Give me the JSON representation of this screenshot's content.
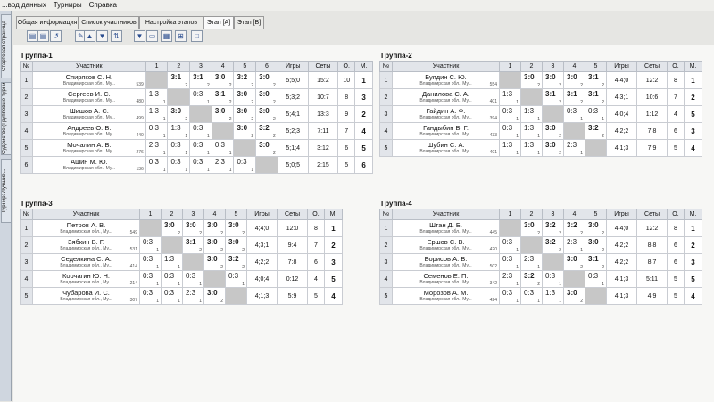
{
  "menu": [
    "...вод данных",
    "Турниры",
    "Справка"
  ],
  "sidebar_tabs": [
    "Стартовая страница",
    "Судейство (Групповые турниры)",
    "Турнир: Лучшие..."
  ],
  "main_tabs": [
    "Общая информация",
    "Список участников",
    "Настройка этапов",
    "Этап [А]",
    "Этап [B]"
  ],
  "active_tab": 3,
  "toolbar_icons": [
    {
      "glyph": "▤",
      "name": "grid-icon"
    },
    {
      "glyph": "▤",
      "name": "grid-icon"
    },
    {
      "glyph": "↺",
      "name": "refresh-icon"
    },
    {
      "glyph": "✎",
      "name": "edit-icon"
    },
    {
      "glyph": "▲",
      "name": "up-arrow-icon"
    },
    {
      "glyph": "▼",
      "name": "down-arrow-icon"
    },
    {
      "glyph": "⇅",
      "name": "sort-icon"
    },
    {
      "glyph": "▼",
      "name": "filter-icon"
    },
    {
      "glyph": "▭",
      "name": "table-icon"
    },
    {
      "glyph": "▦",
      "name": "print-icon"
    },
    {
      "glyph": "⊞",
      "name": "export-icon"
    },
    {
      "glyph": "□",
      "name": "window-icon"
    }
  ],
  "groups": [
    {
      "title": "Группа-1",
      "headers": {
        "no": "№",
        "participant": "Участник",
        "games": "Игры",
        "sets": "Сеты",
        "points": "О.",
        "place": "М.",
        "cols": [
          "1",
          "2",
          "3",
          "4",
          "5",
          "6"
        ]
      },
      "rows": [
        {
          "no": "1",
          "name": "Спиряков С. Н.",
          "region": "Владимирская обл., Му...",
          "rating": "539",
          "results": [
            "",
            {
              "s": "3:1",
              "p": "2"
            },
            {
              "s": "3:1",
              "p": "2"
            },
            {
              "s": "3:0",
              "p": "2"
            },
            {
              "s": "3:2",
              "p": "2"
            },
            {
              "s": "3:0",
              "p": "2"
            }
          ],
          "games": "5;5;0",
          "sets": "15:2",
          "points": "10",
          "place": "1"
        },
        {
          "no": "2",
          "name": "Сергеев И. С.",
          "region": "Владимирская обл., Му...",
          "rating": "480",
          "results": [
            {
              "s": "1:3",
              "p": "1"
            },
            "",
            {
              "s": "0:3",
              "p": "1"
            },
            {
              "s": "3:1",
              "p": "2"
            },
            {
              "s": "3:0",
              "p": "2"
            },
            {
              "s": "3:0",
              "p": "2"
            }
          ],
          "games": "5;3;2",
          "sets": "10:7",
          "points": "8",
          "place": "3"
        },
        {
          "no": "3",
          "name": "Шишов А. С.",
          "region": "Владимирская обл., Му...",
          "rating": "499",
          "results": [
            {
              "s": "1:3",
              "p": "1"
            },
            {
              "s": "3:0",
              "p": "2"
            },
            "",
            {
              "s": "3:0",
              "p": "2"
            },
            {
              "s": "3:0",
              "p": "2"
            },
            {
              "s": "3:0",
              "p": "2"
            }
          ],
          "games": "5;4;1",
          "sets": "13:3",
          "points": "9",
          "place": "2"
        },
        {
          "no": "4",
          "name": "Андреев О. В.",
          "region": "Владимирская обл., Му...",
          "rating": "440",
          "results": [
            {
              "s": "0:3",
              "p": "1"
            },
            {
              "s": "1:3",
              "p": "1"
            },
            {
              "s": "0:3",
              "p": "1"
            },
            "",
            {
              "s": "3:0",
              "p": "2"
            },
            {
              "s": "3:2",
              "p": "2"
            }
          ],
          "games": "5;2;3",
          "sets": "7:11",
          "points": "7",
          "place": "4"
        },
        {
          "no": "5",
          "name": "Мочалин А. В.",
          "region": "Владимирская обл., Му...",
          "rating": "276",
          "results": [
            {
              "s": "2:3",
              "p": "1"
            },
            {
              "s": "0:3",
              "p": "1"
            },
            {
              "s": "0:3",
              "p": "1"
            },
            {
              "s": "0:3",
              "p": "1"
            },
            "",
            {
              "s": "3:0",
              "p": "2"
            }
          ],
          "games": "5;1;4",
          "sets": "3:12",
          "points": "6",
          "place": "5"
        },
        {
          "no": "6",
          "name": "Ашин М. Ю.",
          "region": "Владимирская обл., Му...",
          "rating": "136",
          "results": [
            {
              "s": "0:3",
              "p": "1"
            },
            {
              "s": "0:3",
              "p": "1"
            },
            {
              "s": "0:3",
              "p": "1"
            },
            {
              "s": "2:3",
              "p": "1"
            },
            {
              "s": "0:3",
              "p": "1"
            },
            ""
          ],
          "games": "5;0;5",
          "sets": "2:15",
          "points": "5",
          "place": "6"
        }
      ]
    },
    {
      "title": "Группа-2",
      "headers": {
        "no": "№",
        "participant": "Участник",
        "games": "Игры",
        "sets": "Сеты",
        "points": "О.",
        "place": "М.",
        "cols": [
          "1",
          "2",
          "3",
          "4",
          "5"
        ]
      },
      "rows": [
        {
          "no": "1",
          "name": "Буядин С. Ю.",
          "region": "Владимирская обл., Му...",
          "rating": "554",
          "results": [
            "",
            {
              "s": "3:0",
              "p": "2"
            },
            {
              "s": "3:0",
              "p": "2"
            },
            {
              "s": "3:0",
              "p": "2"
            },
            {
              "s": "3:1",
              "p": "2"
            }
          ],
          "games": "4;4;0",
          "sets": "12:2",
          "points": "8",
          "place": "1"
        },
        {
          "no": "2",
          "name": "Данилова С. А.",
          "region": "Владимирская обл., Му...",
          "rating": "401",
          "results": [
            {
              "s": "1:3",
              "p": "1"
            },
            "",
            {
              "s": "3:1",
              "p": "2"
            },
            {
              "s": "3:1",
              "p": "2"
            },
            {
              "s": "3:1",
              "p": "2"
            }
          ],
          "games": "4;3;1",
          "sets": "10:6",
          "points": "7",
          "place": "2"
        },
        {
          "no": "3",
          "name": "Гайдин А. Ф.",
          "region": "Владимирская обл., Му...",
          "rating": "394",
          "results": [
            {
              "s": "0:3",
              "p": "1"
            },
            {
              "s": "1:3",
              "p": "1"
            },
            "",
            {
              "s": "0:3",
              "p": "1"
            },
            {
              "s": "0:3",
              "p": "1"
            }
          ],
          "games": "4;0;4",
          "sets": "1:12",
          "points": "4",
          "place": "5"
        },
        {
          "no": "4",
          "name": "Гандыбин В. Г.",
          "region": "Владимирская обл., Му...",
          "rating": "433",
          "results": [
            {
              "s": "0:3",
              "p": "1"
            },
            {
              "s": "1:3",
              "p": "1"
            },
            {
              "s": "3:0",
              "p": "2"
            },
            "",
            {
              "s": "3:2",
              "p": "2"
            }
          ],
          "games": "4;2;2",
          "sets": "7:8",
          "points": "6",
          "place": "3"
        },
        {
          "no": "5",
          "name": "Шубин С. А.",
          "region": "Владимирская обл., Му...",
          "rating": "401",
          "results": [
            {
              "s": "1:3",
              "p": "1"
            },
            {
              "s": "1:3",
              "p": "1"
            },
            {
              "s": "3:0",
              "p": "2"
            },
            {
              "s": "2:3",
              "p": "1"
            },
            ""
          ],
          "games": "4;1;3",
          "sets": "7:9",
          "points": "5",
          "place": "4"
        }
      ]
    },
    {
      "title": "Группа-3",
      "headers": {
        "no": "№",
        "participant": "Участник",
        "games": "Игры",
        "sets": "Сеты",
        "points": "О.",
        "place": "М.",
        "cols": [
          "1",
          "2",
          "3",
          "4",
          "5"
        ]
      },
      "rows": [
        {
          "no": "1",
          "name": "Петров А. В.",
          "region": "Владимирская обл., Му...",
          "rating": "549",
          "results": [
            "",
            {
              "s": "3:0",
              "p": "2"
            },
            {
              "s": "3:0",
              "p": "2"
            },
            {
              "s": "3:0",
              "p": "2"
            },
            {
              "s": "3:0",
              "p": "2"
            }
          ],
          "games": "4;4;0",
          "sets": "12:0",
          "points": "8",
          "place": "1"
        },
        {
          "no": "2",
          "name": "Зябкин В. Г.",
          "region": "Владимирская обл., Му...",
          "rating": "531",
          "results": [
            {
              "s": "0:3",
              "p": "1"
            },
            "",
            {
              "s": "3:1",
              "p": "2"
            },
            {
              "s": "3:0",
              "p": "2"
            },
            {
              "s": "3:0",
              "p": "2"
            }
          ],
          "games": "4;3;1",
          "sets": "9:4",
          "points": "7",
          "place": "2"
        },
        {
          "no": "3",
          "name": "Седелкина С. А.",
          "region": "Владимирская обл., Му...",
          "rating": "414",
          "results": [
            {
              "s": "0:3",
              "p": "1"
            },
            {
              "s": "1:3",
              "p": "1"
            },
            "",
            {
              "s": "3:0",
              "p": "2"
            },
            {
              "s": "3:2",
              "p": "2"
            }
          ],
          "games": "4;2;2",
          "sets": "7:8",
          "points": "6",
          "place": "3"
        },
        {
          "no": "4",
          "name": "Корчагин Ю. Н.",
          "region": "Владимирская обл., Му...",
          "rating": "214",
          "results": [
            {
              "s": "0:3",
              "p": "1"
            },
            {
              "s": "0:3",
              "p": "1"
            },
            {
              "s": "0:3",
              "p": "1"
            },
            "",
            {
              "s": "0:3",
              "p": "1"
            }
          ],
          "games": "4;0;4",
          "sets": "0:12",
          "points": "4",
          "place": "5"
        },
        {
          "no": "5",
          "name": "Чубарова И. С.",
          "region": "Владимирская обл., Му...",
          "rating": "307",
          "results": [
            {
              "s": "0:3",
              "p": "1"
            },
            {
              "s": "0:3",
              "p": "1"
            },
            {
              "s": "2:3",
              "p": "1"
            },
            {
              "s": "3:0",
              "p": "2"
            },
            ""
          ],
          "games": "4;1;3",
          "sets": "5:9",
          "points": "5",
          "place": "4"
        }
      ]
    },
    {
      "title": "Группа-4",
      "headers": {
        "no": "№",
        "participant": "Участник",
        "games": "Игры",
        "sets": "Сеты",
        "points": "О.",
        "place": "М.",
        "cols": [
          "1",
          "2",
          "3",
          "4",
          "5"
        ]
      },
      "rows": [
        {
          "no": "1",
          "name": "Штан Д. Б.",
          "region": "Владимирская обл., Му...",
          "rating": "445",
          "results": [
            "",
            {
              "s": "3:0",
              "p": "2"
            },
            {
              "s": "3:2",
              "p": "2"
            },
            {
              "s": "3:2",
              "p": "2"
            },
            {
              "s": "3:0",
              "p": "2"
            }
          ],
          "games": "4;4;0",
          "sets": "12:2",
          "points": "8",
          "place": "1"
        },
        {
          "no": "2",
          "name": "Ершов С. В.",
          "region": "Владимирская обл., Му...",
          "rating": "420",
          "results": [
            {
              "s": "0:3",
              "p": "1"
            },
            "",
            {
              "s": "3:2",
              "p": "2"
            },
            {
              "s": "2:3",
              "p": "1"
            },
            {
              "s": "3:0",
              "p": "2"
            }
          ],
          "games": "4;2;2",
          "sets": "8:8",
          "points": "6",
          "place": "2"
        },
        {
          "no": "3",
          "name": "Борисов А. В.",
          "region": "Владимирская обл., Му...",
          "rating": "502",
          "results": [
            {
              "s": "0:3",
              "p": "1"
            },
            {
              "s": "2:3",
              "p": "1"
            },
            "",
            {
              "s": "3:0",
              "p": "2"
            },
            {
              "s": "3:1",
              "p": "2"
            }
          ],
          "games": "4;2;2",
          "sets": "8:7",
          "points": "6",
          "place": "3"
        },
        {
          "no": "4",
          "name": "Семенов Е. П.",
          "region": "Владимирская обл., Му...",
          "rating": "342",
          "results": [
            {
              "s": "2:3",
              "p": "1"
            },
            {
              "s": "3:2",
              "p": "2"
            },
            {
              "s": "0:3",
              "p": "1"
            },
            "",
            {
              "s": "0:3",
              "p": "1"
            }
          ],
          "games": "4;1;3",
          "sets": "5:11",
          "points": "5",
          "place": "5"
        },
        {
          "no": "5",
          "name": "Морозов А. М.",
          "region": "Владимирская обл., Му...",
          "rating": "424",
          "results": [
            {
              "s": "0:3",
              "p": "1"
            },
            {
              "s": "0:3",
              "p": "1"
            },
            {
              "s": "1:3",
              "p": "1"
            },
            {
              "s": "3:0",
              "p": "2"
            },
            ""
          ],
          "games": "4;1;3",
          "sets": "4:9",
          "points": "5",
          "place": "4"
        }
      ]
    }
  ]
}
